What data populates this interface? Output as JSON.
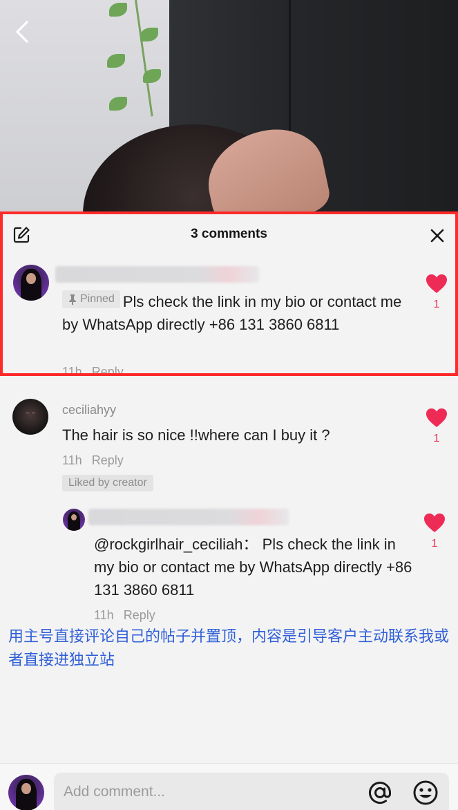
{
  "header": {
    "comment_count_label": "3 comments"
  },
  "comments": [
    {
      "username": "",
      "pinned_label": "Pinned",
      "text": "Pls check the link in my bio or contact me by WhatsApp directly +86 131 3860 6811",
      "time": "11h",
      "reply_label": "Reply",
      "likes": "1"
    },
    {
      "username": "ceciliahyy",
      "text": "The hair is so nice !!where can I buy it ?",
      "time": "11h",
      "reply_label": "Reply",
      "badge": "Liked by creator",
      "likes": "1"
    },
    {
      "username": "",
      "text": "@rockgirlhair_ceciliah： Pls check the link in my bio or contact me by WhatsApp directly +86 131 3860 6811",
      "time": "11h",
      "reply_label": "Reply",
      "likes": "1"
    }
  ],
  "annotation": "用主号直接评论自己的帖子并置顶，内容是引导客户主动联系我或者直接进独立站",
  "input": {
    "placeholder": "Add comment..."
  },
  "colors": {
    "accent_red": "#ee2b55",
    "highlight_border": "#ff2a2a",
    "annotation_blue": "#2f5fd8"
  },
  "icons": [
    "back-icon",
    "edit-icon",
    "close-icon",
    "heart-icon",
    "pin-icon",
    "at-icon",
    "emoji-icon"
  ]
}
